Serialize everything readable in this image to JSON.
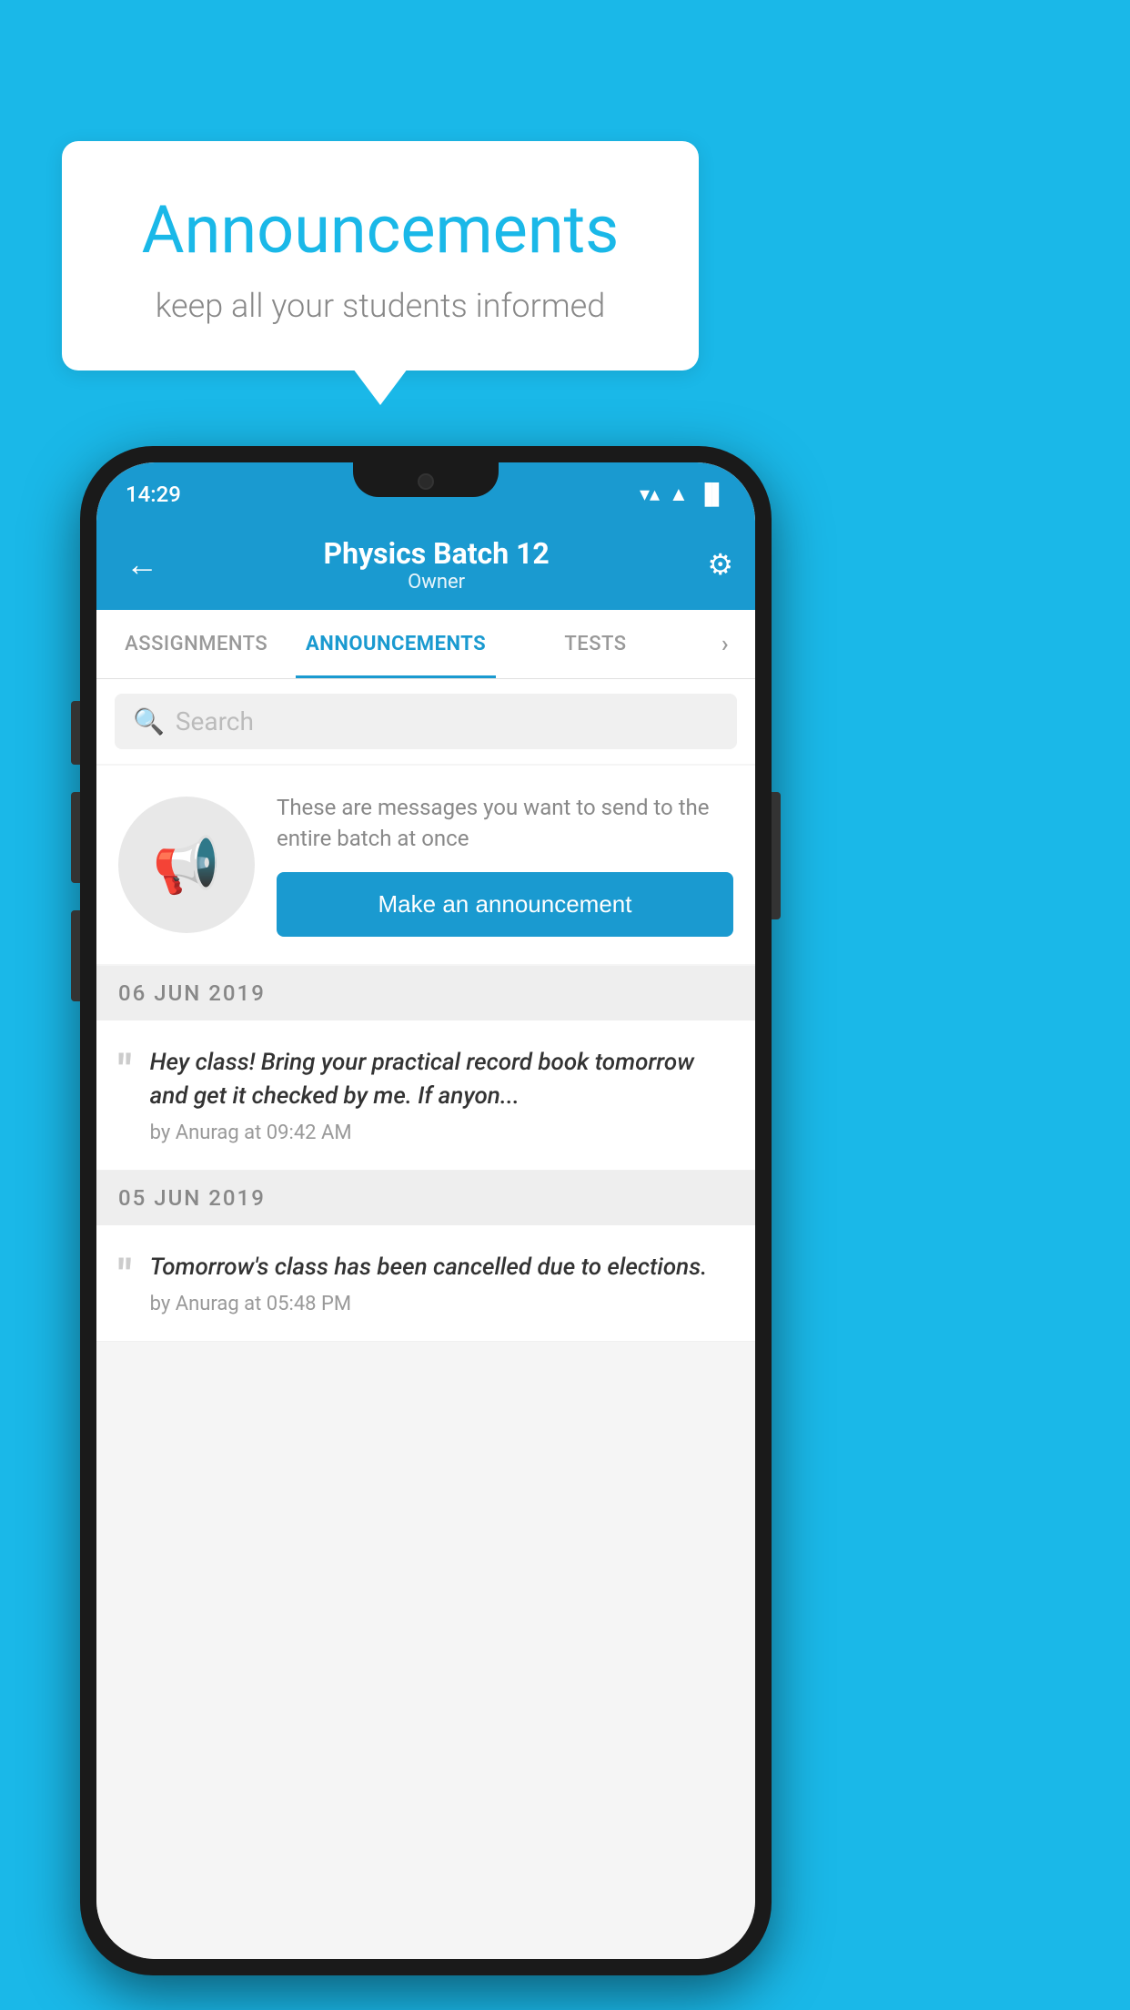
{
  "background_color": "#1ab8e8",
  "speech_bubble": {
    "title": "Announcements",
    "subtitle": "keep all your students informed"
  },
  "phone": {
    "status_bar": {
      "time": "14:29",
      "wifi": "▼",
      "signal": "▲",
      "battery": "▌"
    },
    "top_bar": {
      "back_label": "←",
      "title": "Physics Batch 12",
      "subtitle": "Owner",
      "settings_label": "⚙"
    },
    "tabs": [
      {
        "label": "ASSIGNMENTS",
        "active": false
      },
      {
        "label": "ANNOUNCEMENTS",
        "active": true
      },
      {
        "label": "TESTS",
        "active": false
      },
      {
        "label": "›",
        "active": false
      }
    ],
    "search": {
      "placeholder": "Search"
    },
    "empty_state": {
      "description": "These are messages you want to send to the entire batch at once",
      "button_label": "Make an announcement"
    },
    "announcements": [
      {
        "date": "06  JUN  2019",
        "messages": [
          {
            "text": "Hey class! Bring your practical record book tomorrow and get it checked by me. If anyon...",
            "author": "by Anurag at 09:42 AM"
          }
        ]
      },
      {
        "date": "05  JUN  2019",
        "messages": [
          {
            "text": "Tomorrow's class has been cancelled due to elections.",
            "author": "by Anurag at 05:48 PM"
          }
        ]
      }
    ]
  }
}
